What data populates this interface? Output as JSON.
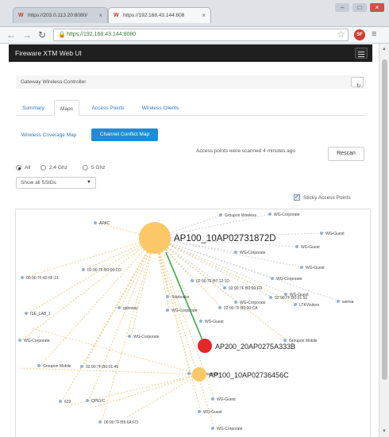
{
  "browser": {
    "tabs": [
      {
        "label": "https://203.0.113.20:8080/"
      },
      {
        "label": "https://192.168.43.144:808"
      }
    ],
    "url_display": "https://192.168.43.144:8080",
    "extension_label": "SF"
  },
  "app": {
    "title": "Fireware XTM Web UI",
    "page_title": "Gateway Wireless Controller",
    "tabs": [
      "Summary",
      "Maps",
      "Access Points",
      "Wireless Clients"
    ],
    "subnav": {
      "coverage": "Wireless Coverage Map",
      "conflict": "Channel Conflict Map"
    },
    "scan_status": "Access points were scanned 4 minutes ago",
    "rescan_label": "Rescan",
    "bands": [
      "All",
      "2.4 Ghz",
      "5 Ghz"
    ],
    "ssid_select": "Show all SSIDs",
    "sticky_label": "Sticky Access Points"
  },
  "map": {
    "hub_label": "AP100_10AP02731872D",
    "red_label": "AP200_20AP0275A333B",
    "small_label": "AP100_10AP02736456C",
    "nodes": [
      "Groupon Wireless",
      "WG-Corporate",
      "APAC",
      "WG-Guest",
      "WG-Guest",
      "WG-Corporate",
      "WG-Guest",
      "02:90:7F:B0:00:CD",
      "00:90:7F:82:5F:21",
      "WG-Corporate",
      "02:90:7F:B7:12:1D",
      "02:90:7F:B0:00:FD",
      "Starbucks",
      "WG-Corporate",
      "WG-Guest",
      "WG-Corporate",
      "02:90:7F:B0:01:51",
      "LTKVisitors",
      "ISE_LAB_1",
      "gateway",
      "02:90:7F:B0:00:CA",
      "WG-Corporate",
      "WG-Corporate",
      "Groupon Mobile",
      "WG-Guest",
      "Groupon Mobile",
      "02:90:7F:B0:01:45",
      "WG-Corporate",
      "WG-Guest",
      "629",
      "QPEVC",
      "WG-Guest",
      "00:90:7F:B5:6A:FD",
      "WG-Corporate",
      "wemia"
    ]
  }
}
